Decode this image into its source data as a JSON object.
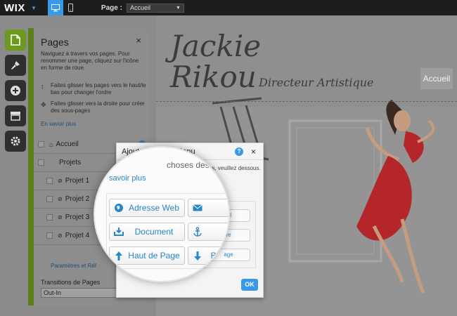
{
  "topbar": {
    "logo": "WIX",
    "page_label": "Page :",
    "page_value": "Accueil"
  },
  "site": {
    "name_line1": "Jackie",
    "name_line2": "Rikou",
    "role": "Directeur Artistique",
    "nav_item": "Accueil"
  },
  "rail": {
    "items": [
      "pages-icon",
      "design-icon",
      "add-icon",
      "store-icon",
      "settings-icon"
    ]
  },
  "pages_panel": {
    "title": "Pages",
    "close": "×",
    "intro": "Naviguez à travers vos pages. Pour renommer une page, cliquez sur l'icône en forme de roue.",
    "tip1": "Faites glisser les pages vers le haut/le bas pour changer l'ordre",
    "tip2": "Faites glisser vers la droite pour créer des sous-pages",
    "learn_more": "En savoir plus",
    "pages": [
      "Accueil",
      "Projets",
      "Projet 1",
      "Projet 2",
      "Projet 3",
      "Projet 4"
    ],
    "params": "Paramètres et Réf",
    "transitions_label": "Transitions de Pages",
    "transitions_value": "Out-In"
  },
  "dialog": {
    "title": "Ajouter Lien au Menu",
    "help": "?",
    "close": "×",
    "desc": "u Pages, veuillez dessous.",
    "btn_right_1": "ail",
    "btn_right_2": "re",
    "btn_right_3": "age",
    "ok": "OK"
  },
  "magnifier": {
    "top_fragment": "choses des s",
    "learn_more": "savoir plus",
    "buttons": [
      {
        "label": "Adresse Web",
        "icon": "globe-icon"
      },
      {
        "label": "E",
        "icon": "envelope-icon"
      },
      {
        "label": "Document",
        "icon": "download-icon"
      },
      {
        "label": "A",
        "icon": "anchor-icon"
      },
      {
        "label": "Haut de Page",
        "icon": "arrow-up-icon"
      },
      {
        "label": "Ba de Page",
        "icon": "arrow-down-icon"
      }
    ]
  },
  "colors": {
    "accent": "#3899ec",
    "active_green": "#6b9a1f",
    "topbar": "#1d1d1d"
  }
}
